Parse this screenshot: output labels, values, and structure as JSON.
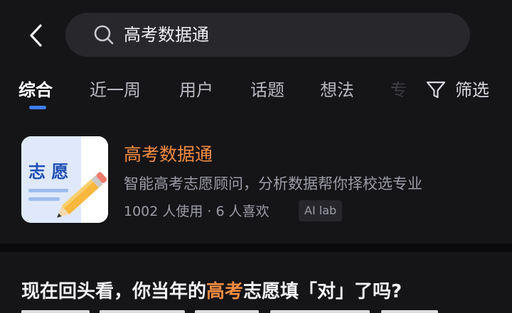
{
  "search": {
    "query": "高考数据通"
  },
  "tabs": [
    {
      "label": "综合",
      "active": true
    },
    {
      "label": "近一周",
      "active": false
    },
    {
      "label": "用户",
      "active": false
    },
    {
      "label": "话题",
      "active": false
    },
    {
      "label": "想法",
      "active": false
    },
    {
      "label": "专",
      "active": false
    }
  ],
  "filter": {
    "label": "筛选"
  },
  "app_card": {
    "icon_text": "志 愿",
    "title": "高考数据通",
    "description": "智能高考志愿顾问，分析数据帮你择校选专业",
    "stats": "1002 人使用 · 6 人喜欢",
    "badge": "AI lab"
  },
  "question": {
    "title_before": "现在回头看，你当年的",
    "title_highlight": "高考",
    "title_after": "志愿填「对」了吗?"
  },
  "colors": {
    "background": "#151518",
    "accent_orange": "#f28b42",
    "tab_indicator": "#3f7ef6",
    "search_bg": "#27272c"
  }
}
